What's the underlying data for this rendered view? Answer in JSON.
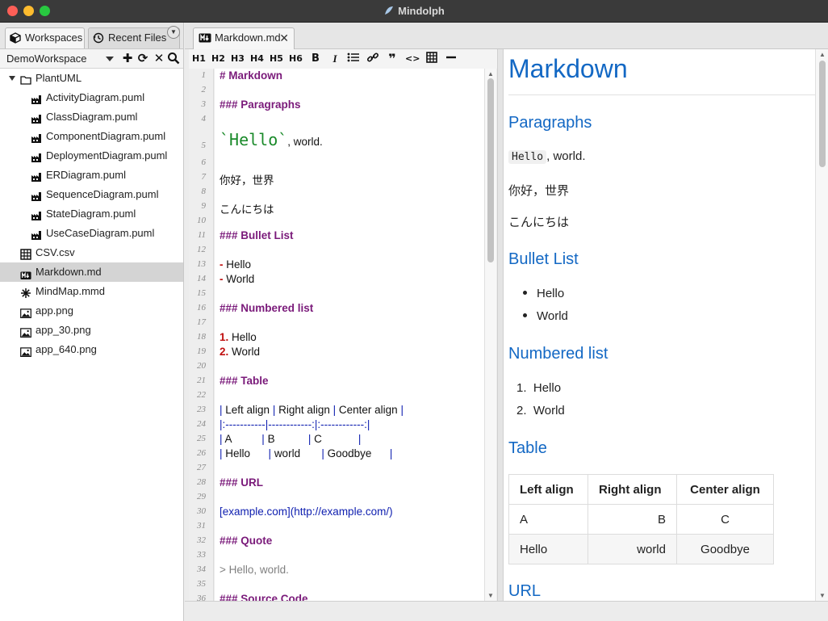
{
  "window": {
    "title": "Mindolph"
  },
  "left_tabs": [
    {
      "label": "Workspaces",
      "icon": "cube-icon"
    },
    {
      "label": "Recent Files",
      "icon": "history-icon"
    }
  ],
  "workspace": {
    "name": "DemoWorkspace"
  },
  "tree": [
    {
      "label": "PlantUML",
      "icon": "folder-icon",
      "level": 0,
      "expanded": true
    },
    {
      "label": "ActivityDiagram.puml",
      "icon": "plantuml-icon",
      "level": 1
    },
    {
      "label": "ClassDiagram.puml",
      "icon": "plantuml-icon",
      "level": 1
    },
    {
      "label": "ComponentDiagram.puml",
      "icon": "plantuml-icon",
      "level": 1
    },
    {
      "label": "DeploymentDiagram.puml",
      "icon": "plantuml-icon",
      "level": 1
    },
    {
      "label": "ERDiagram.puml",
      "icon": "plantuml-icon",
      "level": 1
    },
    {
      "label": "SequenceDiagram.puml",
      "icon": "plantuml-icon",
      "level": 1
    },
    {
      "label": "StateDiagram.puml",
      "icon": "plantuml-icon",
      "level": 1
    },
    {
      "label": "UseCaseDiagram.puml",
      "icon": "plantuml-icon",
      "level": 1
    },
    {
      "label": "CSV.csv",
      "icon": "table-icon",
      "level": 0
    },
    {
      "label": "Markdown.md",
      "icon": "markdown-icon",
      "level": 0,
      "selected": true
    },
    {
      "label": "MindMap.mmd",
      "icon": "mindmap-icon",
      "level": 0
    },
    {
      "label": "app.png",
      "icon": "image-icon",
      "level": 0
    },
    {
      "label": "app_30.png",
      "icon": "image-icon",
      "level": 0
    },
    {
      "label": "app_640.png",
      "icon": "image-icon",
      "level": 0
    }
  ],
  "editor_tab": {
    "label": "Markdown.md",
    "close": "✕"
  },
  "toolbar": {
    "h1": "H1",
    "h2": "H2",
    "h3": "H3",
    "h4": "H4",
    "h5": "H5",
    "h6": "H6",
    "bold": "B",
    "italic": "I"
  },
  "code_lines": [
    {
      "n": "1",
      "t": "# Markdown",
      "k": "h"
    },
    {
      "n": "2",
      "t": ""
    },
    {
      "n": "3",
      "t": "### Paragraphs",
      "k": "h"
    },
    {
      "n": "4",
      "t": ""
    },
    {
      "n": "5",
      "mono": "`Hello`",
      "rest": ", world."
    },
    {
      "n": "6",
      "t": ""
    },
    {
      "n": "7",
      "t": "你好，世界"
    },
    {
      "n": "8",
      "t": ""
    },
    {
      "n": "9",
      "t": "こんにちは"
    },
    {
      "n": "10",
      "t": ""
    },
    {
      "n": "11",
      "t": "### Bullet List",
      "k": "h"
    },
    {
      "n": "12",
      "t": ""
    },
    {
      "n": "13",
      "mark": "-",
      "rest": " Hello"
    },
    {
      "n": "14",
      "mark": "-",
      "rest": " World"
    },
    {
      "n": "15",
      "t": ""
    },
    {
      "n": "16",
      "t": "### Numbered list",
      "k": "h"
    },
    {
      "n": "17",
      "t": ""
    },
    {
      "n": "18",
      "mark": "1.",
      "rest": " Hello"
    },
    {
      "n": "19",
      "mark": "2.",
      "rest": " World"
    },
    {
      "n": "20",
      "t": ""
    },
    {
      "n": "21",
      "t": "### Table",
      "k": "h"
    },
    {
      "n": "22",
      "t": ""
    },
    {
      "n": "23",
      "row": [
        "| ",
        "Left align ",
        "| ",
        "Right align ",
        "| ",
        "Center align ",
        "|"
      ]
    },
    {
      "n": "24",
      "row": [
        "|:-----------|------------:|:------------:|"
      ]
    },
    {
      "n": "25",
      "row": [
        "| ",
        "A          ",
        "| ",
        "B           ",
        "| ",
        "C            ",
        "|"
      ]
    },
    {
      "n": "26",
      "row": [
        "| ",
        "Hello      ",
        "| ",
        "world       ",
        "| ",
        "Goodbye      ",
        "|"
      ]
    },
    {
      "n": "27",
      "t": ""
    },
    {
      "n": "28",
      "t": "### URL",
      "k": "h"
    },
    {
      "n": "29",
      "t": ""
    },
    {
      "n": "30",
      "t": "[example.com](http://example.com/)",
      "k": "link"
    },
    {
      "n": "31",
      "t": ""
    },
    {
      "n": "32",
      "t": "### Quote",
      "k": "h"
    },
    {
      "n": "33",
      "t": ""
    },
    {
      "n": "34",
      "t": "> Hello, world.",
      "k": "quote"
    },
    {
      "n": "35",
      "t": ""
    },
    {
      "n": "36",
      "t": "### Source Code",
      "k": "h"
    }
  ],
  "preview": {
    "h1": "Markdown",
    "paragraphs": "Paragraphs",
    "hello_code": "Hello",
    "hello_rest": ", world.",
    "chinese": "你好，世界",
    "japanese": "こんにちは",
    "bullet_list": "Bullet List",
    "bullets": [
      "Hello",
      "World"
    ],
    "numbered_list": "Numbered list",
    "numbered": [
      "Hello",
      "World"
    ],
    "numbered_marks": [
      "1.",
      "2."
    ],
    "table": "Table",
    "table_headers": [
      "Left align",
      "Right align",
      "Center align"
    ],
    "table_rows": [
      [
        "A",
        "B",
        "C"
      ],
      [
        "Hello",
        "world",
        "Goodbye"
      ]
    ],
    "url": "URL"
  },
  "colors": {
    "heading_preview": "#1368c4",
    "heading_source": "#7a1a7a",
    "pipe": "#1020b0",
    "bullet_mark": "#c01010"
  }
}
